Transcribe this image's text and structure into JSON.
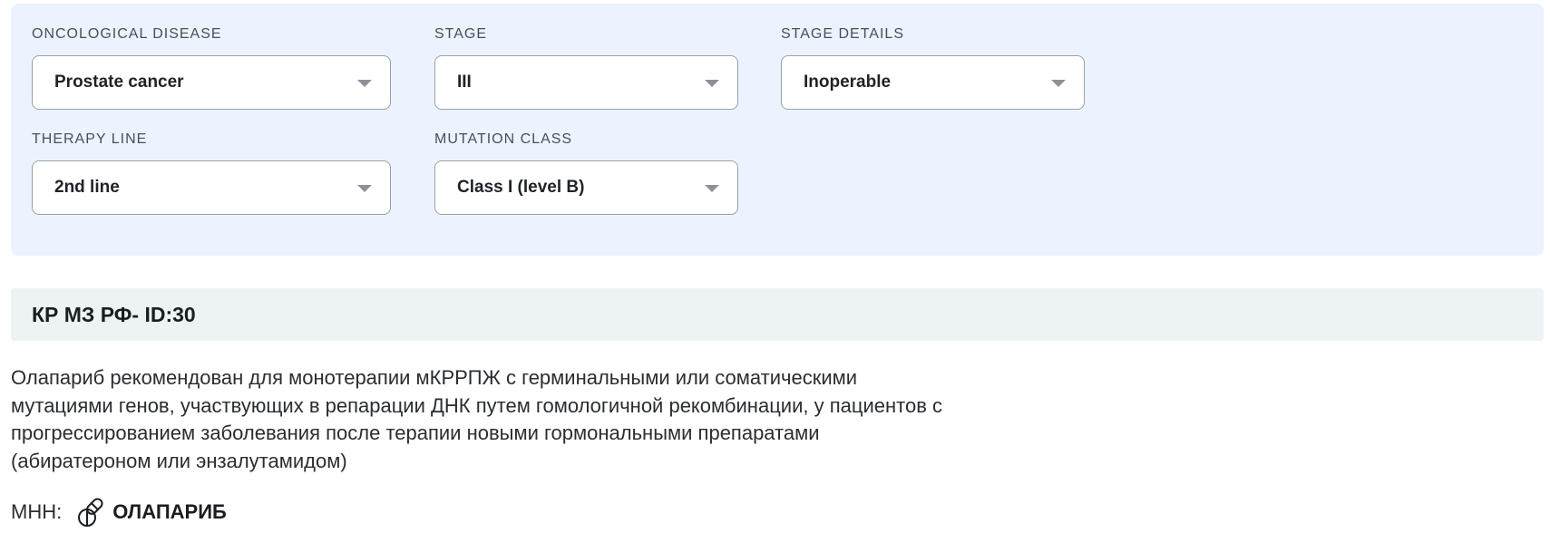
{
  "filters": {
    "oncological_disease": {
      "label": "ONCOLOGICAL DISEASE",
      "value": "Prostate cancer"
    },
    "stage": {
      "label": "STAGE",
      "value": "III"
    },
    "stage_details": {
      "label": "STAGE DETAILS",
      "value": "Inoperable"
    },
    "therapy_line": {
      "label": "THERAPY LINE",
      "value": "2nd line"
    },
    "mutation_class": {
      "label": "MUTATION CLASS",
      "value": "Class I (level B)"
    }
  },
  "guideline": {
    "id_text": "КР МЗ РФ- ID:30",
    "description": "Олапариб рекомендован для монотерапии мКРРПЖ с герминальными или соматическими мутациями генов, участвующих в репарации ДНК путем гомологичной рекомбинации, у пациентов с прогрессированием заболевания после терапии новыми гормональными препаратами (абиратероном или энзалутамидом)",
    "inn_label": "МНН:",
    "inn_icon": "pills-icon",
    "inn_value": "ОЛАПАРИБ"
  }
}
